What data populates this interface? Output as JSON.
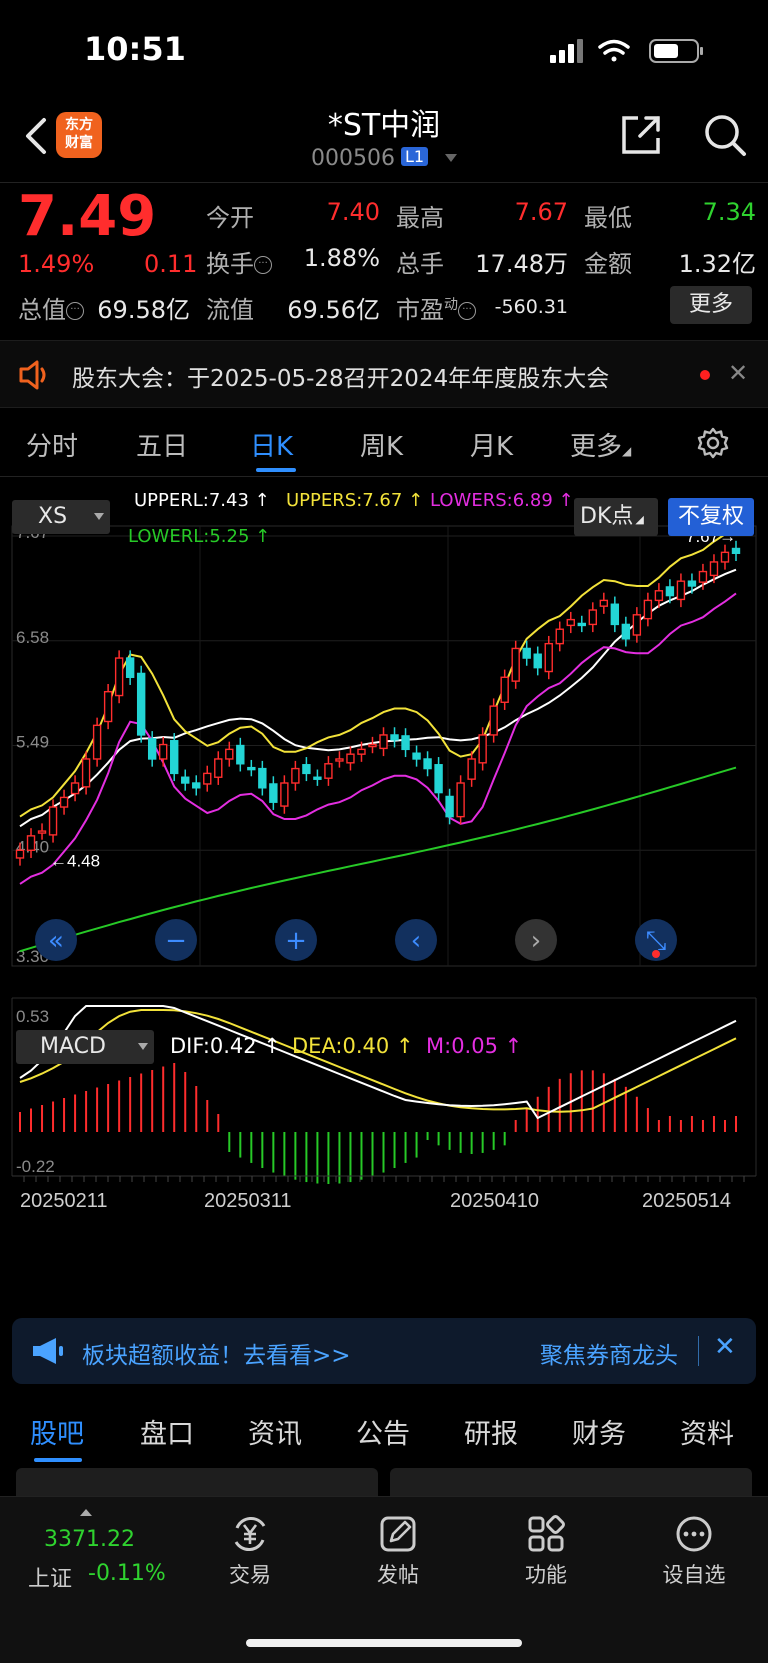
{
  "status_bar": {
    "time": "10:51"
  },
  "header": {
    "logo_text_1": "东方",
    "logo_text_2": "财富",
    "stock_name": "*ST中润",
    "stock_code": "000506",
    "level_badge": "L1"
  },
  "quote": {
    "last_price": "7.49",
    "change_pct": "1.49%",
    "change_amt": "0.11",
    "open_label": "今开",
    "open": "7.40",
    "high_label": "最高",
    "high": "7.67",
    "low_label": "最低",
    "low": "7.34",
    "turnover_rate_label": "换手",
    "turnover_rate": "1.88%",
    "volume_label": "总手",
    "volume": "17.48万",
    "amount_label": "金额",
    "amount": "1.32亿",
    "total_mv_label": "总值",
    "total_mv": "69.58亿",
    "float_mv_label": "流值",
    "float_mv": "69.56亿",
    "pe_label": "市盈",
    "pe_sup": "动",
    "pe": "-560.31",
    "more_label": "更多"
  },
  "notice": {
    "text": "股东大会：于2025-05-28召开2024年年度股东大会"
  },
  "period_tabs": [
    "分时",
    "五日",
    "日K",
    "周K",
    "月K",
    "更多"
  ],
  "chart": {
    "indicator_selector": "XS",
    "upperl": "UPPERL:7.43",
    "uppers": "UPPERS:7.67",
    "lowers": "LOWERS:6.89",
    "lowerl": "LOWERL:5.25",
    "dk_label": "DK点",
    "fq_label": "不复权",
    "y_ticks": [
      "7.67",
      "6.58",
      "5.49",
      "4.40",
      "3.30"
    ],
    "high_marker": "7.67",
    "low_marker": "4.48",
    "macd_selector": "MACD",
    "dif": "DIF:0.42",
    "dea": "DEA:0.40",
    "m": "M:0.05",
    "macd_ticks": [
      "0.53",
      "-0.22"
    ],
    "dates": [
      "20250211",
      "20250311",
      "20250410",
      "20250514"
    ],
    "colors": {
      "up": "#ff2d2d",
      "down": "#23d5d5",
      "upperl": "#ffffff",
      "uppers": "#f2e23a",
      "lowers": "#e32ee0",
      "lowerl": "#27c927"
    }
  },
  "chart_data": {
    "type": "candlestick",
    "ylim": [
      3.3,
      7.67
    ],
    "x": [
      "20250211",
      "20250311",
      "20250410",
      "20250514"
    ],
    "last_values": {
      "UPPERL": 7.43,
      "UPPERS": 7.67,
      "LOWERS": 6.89,
      "LOWERL": 5.25,
      "DIF": 0.42,
      "DEA": 0.4,
      "M": 0.05
    },
    "macd_ylim": [
      -0.22,
      0.53
    ]
  },
  "ad": {
    "left_text": "板块超额收益！去看看>>",
    "right_text": "聚焦券商龙头"
  },
  "content_tabs": [
    "股吧",
    "盘口",
    "资讯",
    "公告",
    "研报",
    "财务",
    "资料"
  ],
  "bottom_nav": {
    "index_value": "3371.22",
    "index_name": "上证",
    "index_change": "-0.11%",
    "items": [
      "交易",
      "发帖",
      "功能",
      "设自选"
    ]
  }
}
